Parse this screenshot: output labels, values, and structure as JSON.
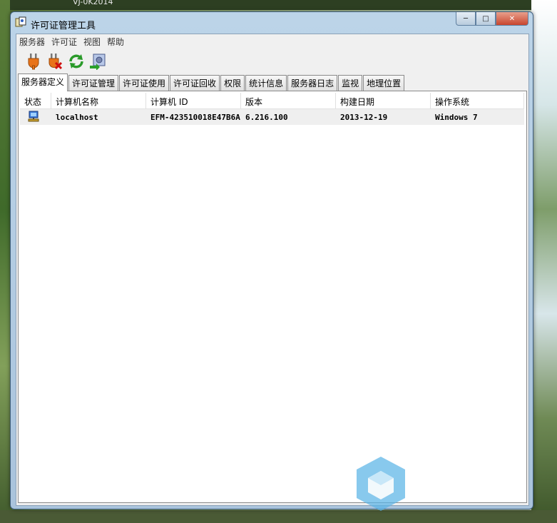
{
  "desktop": {
    "caption": "VJ-0K2014"
  },
  "window": {
    "title": "许可证管理工具",
    "buttons": {
      "minimize": "─",
      "maximize": "□",
      "close": "✕"
    }
  },
  "menu": [
    "服务器",
    "许可证",
    "视图",
    "帮助"
  ],
  "toolbar": {
    "icons": [
      "connect-plug-icon",
      "disconnect-plug-icon",
      "refresh-icon",
      "export-icon"
    ]
  },
  "tabs": {
    "active": 0,
    "labels": [
      "服务器定义",
      "许可证管理",
      "许可证使用",
      "许可证回收",
      "权限",
      "统计信息",
      "服务器日志",
      "监视",
      "地理位置"
    ]
  },
  "table": {
    "columns": [
      "状态",
      "计算机名称",
      "计算机 ID",
      "版本",
      "构建日期",
      "操作系统"
    ],
    "rows": [
      {
        "status_icon": "computer-icon",
        "name": "localhost",
        "id": "EFM-423510018E47B6A",
        "version": "6.216.100",
        "build_date": "2013-12-19",
        "os": "Windows 7"
      }
    ]
  },
  "colors": {
    "title_bar": "#bcd4e8",
    "close_button": "#c8462e",
    "accent": "#3399ff"
  }
}
